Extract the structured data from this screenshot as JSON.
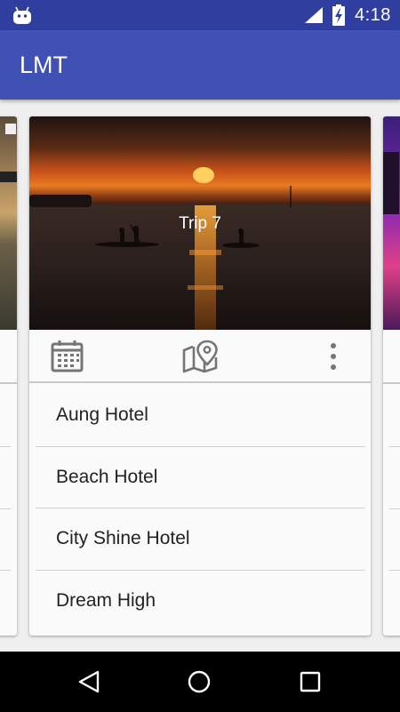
{
  "status_bar": {
    "time": "4:18",
    "icons": [
      "android-icon",
      "signal-icon",
      "battery-charging-icon"
    ]
  },
  "app_bar": {
    "title": "LMT"
  },
  "trip_card": {
    "title": "Trip 7",
    "actions": [
      "calendar-icon",
      "map-pin-icon",
      "more-vert-icon"
    ],
    "hotels": [
      "Aung Hotel",
      "Beach Hotel",
      "City Shine Hotel",
      "Dream High"
    ]
  },
  "nav_bar": {
    "icons": [
      "back-icon",
      "home-icon",
      "recents-icon"
    ]
  },
  "colors": {
    "status_bar": "#303f9f",
    "app_bar": "#3f51b5",
    "card_bg": "#fafafa",
    "icon_gray": "#757575"
  }
}
